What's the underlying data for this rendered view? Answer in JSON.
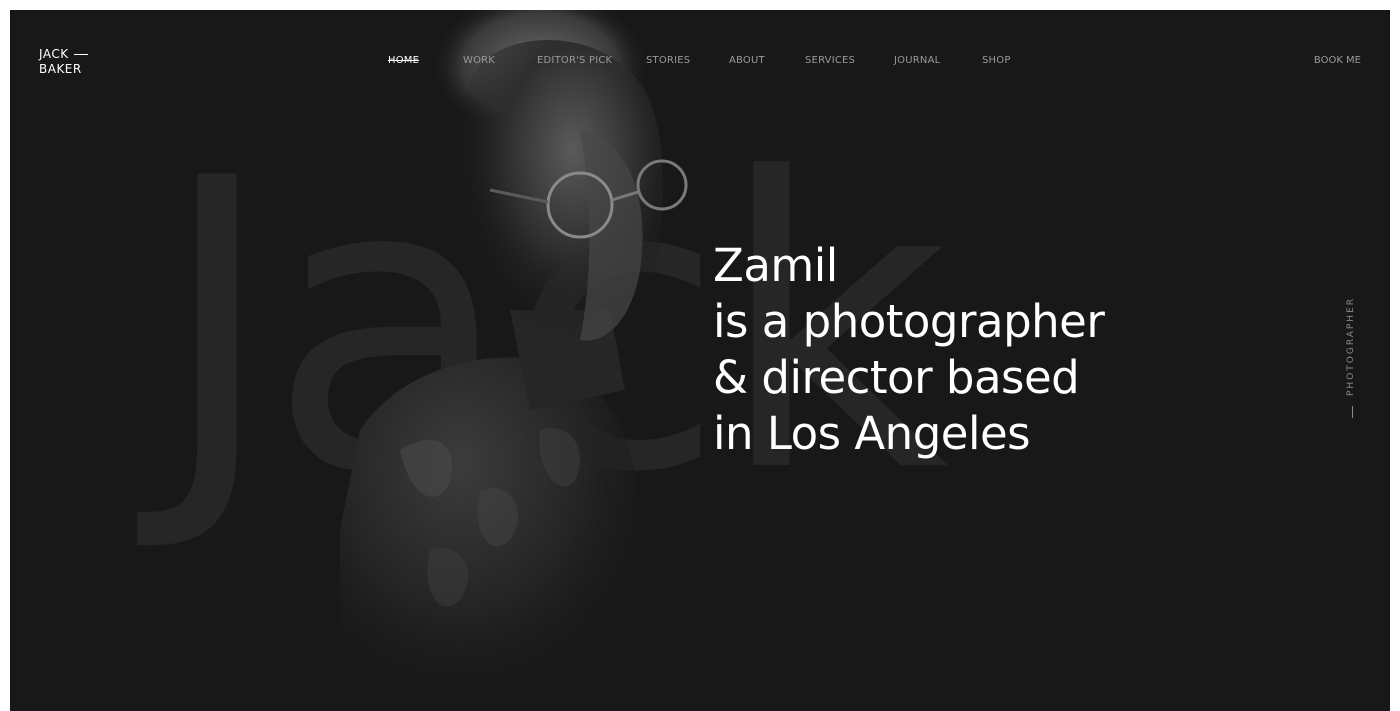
{
  "brand": {
    "line1": "JACK",
    "line2": "BAKER"
  },
  "nav": {
    "items": [
      {
        "label": "HOME",
        "active": true
      },
      {
        "label": "WORK",
        "active": false
      },
      {
        "label": "EDITOR'S PICK",
        "active": false
      },
      {
        "label": "STORIES",
        "active": false
      },
      {
        "label": "ABOUT",
        "active": false
      },
      {
        "label": "SERVICES",
        "active": false
      },
      {
        "label": "JOURNAL",
        "active": false
      },
      {
        "label": "SHOP",
        "active": false
      }
    ],
    "cta": "BOOK ME"
  },
  "hero": {
    "background_word": "Jack",
    "headline_lines": [
      "Zamil",
      "is a photographer",
      "& director based",
      "in Los Angeles"
    ],
    "side_label": "PHOTOGRAPHER"
  },
  "colors": {
    "background": "#181818",
    "text_primary": "#ffffff",
    "text_muted": "#9a9a9a",
    "bg_word": "#262626"
  }
}
